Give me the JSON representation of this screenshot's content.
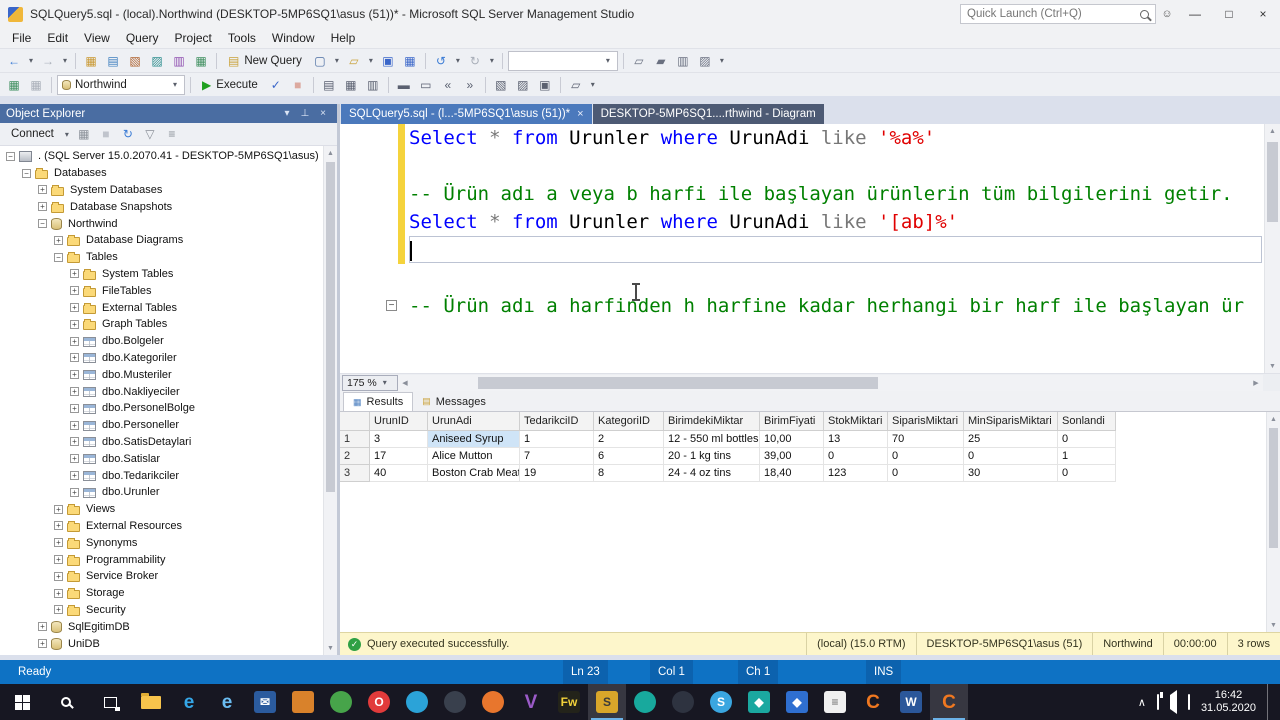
{
  "titlebar": {
    "title": "SQLQuery5.sql - (local).Northwind (DESKTOP-5MP6SQ1\\asus (51))* - Microsoft SQL Server Management Studio",
    "quick_launch_placeholder": "Quick Launch (Ctrl+Q)",
    "window_buttons": [
      {
        "n": "minimize-button",
        "g": "—"
      },
      {
        "n": "maximize-button",
        "g": "□"
      },
      {
        "n": "close-button",
        "g": "×"
      }
    ]
  },
  "menubar": {
    "items": [
      "File",
      "Edit",
      "View",
      "Query",
      "Project",
      "Tools",
      "Window",
      "Help"
    ]
  },
  "toolbar_standard": {
    "items": [
      {
        "t": "i",
        "n": "back-button",
        "g": "←",
        "c": "#3a7bd5"
      },
      {
        "t": "v",
        "n": "back-history-dropdown"
      },
      {
        "t": "i",
        "n": "forward-button",
        "g": "→",
        "c": "#a8aeb8"
      },
      {
        "t": "v",
        "n": "forward-history-dropdown"
      },
      {
        "t": "s"
      },
      {
        "t": "i",
        "n": "new-project-icon",
        "g": "▦",
        "c": "#c9972f"
      },
      {
        "t": "i",
        "n": "database-engine-query-icon",
        "g": "▤",
        "c": "#3f7fbf"
      },
      {
        "t": "i",
        "n": "analysis-services-query-icon",
        "g": "▧",
        "c": "#b0632f"
      },
      {
        "t": "i",
        "n": "mdx-query-icon",
        "g": "▨",
        "c": "#2f8f8f"
      },
      {
        "t": "i",
        "n": "dmx-query-icon",
        "g": "▥",
        "c": "#8f4fb0"
      },
      {
        "t": "i",
        "n": "xmla-query-icon",
        "g": "▦",
        "c": "#3f8f5f"
      },
      {
        "t": "s"
      },
      {
        "t": "b",
        "n": "new-query-button",
        "g": "▤",
        "c": "#caa23a",
        "label": "New Query"
      },
      {
        "t": "i",
        "n": "new-file-icon",
        "g": "▢",
        "c": "#4a6da2"
      },
      {
        "t": "v",
        "n": "new-file-dropdown"
      },
      {
        "t": "i",
        "n": "open-file-icon",
        "g": "▱",
        "c": "#caa23a"
      },
      {
        "t": "v",
        "n": "open-file-dropdown"
      },
      {
        "t": "i",
        "n": "save-icon",
        "g": "▣",
        "c": "#3a66c9"
      },
      {
        "t": "i",
        "n": "save-all-icon",
        "g": "▦",
        "c": "#3a66c9"
      },
      {
        "t": "s"
      },
      {
        "t": "i",
        "n": "undo-icon",
        "g": "↺",
        "c": "#3a7bd5"
      },
      {
        "t": "v",
        "n": "undo-dropdown"
      },
      {
        "t": "i",
        "n": "redo-icon",
        "g": "↻",
        "c": "#a8aeb8"
      },
      {
        "t": "v",
        "n": "redo-dropdown"
      },
      {
        "t": "s"
      },
      {
        "t": "c",
        "n": "deployment-target-combo",
        "v": "",
        "w": 110
      },
      {
        "t": "s"
      },
      {
        "t": "i",
        "n": "solution-explorer-icon",
        "g": "▱",
        "c": "#6a7080"
      },
      {
        "t": "i",
        "n": "properties-window-icon",
        "g": "▰",
        "c": "#6a7080"
      },
      {
        "t": "i",
        "n": "object-explorer-icon",
        "g": "▥",
        "c": "#6a7080"
      },
      {
        "t": "i",
        "n": "toolbox-icon",
        "g": "▨",
        "c": "#6a7080"
      },
      {
        "t": "v",
        "n": "toolbar-overflow-dropdown"
      }
    ]
  },
  "toolbar_sql": {
    "items": [
      {
        "t": "i",
        "n": "connect-icon",
        "g": "▦",
        "c": "#3f8f5f"
      },
      {
        "t": "i",
        "n": "change-connection-icon",
        "g": "▦",
        "c": "#a8aeb8"
      },
      {
        "t": "s"
      },
      {
        "t": "c",
        "n": "available-databases-combo",
        "v": "Northwind",
        "w": 128,
        "ic": "db"
      },
      {
        "t": "s"
      },
      {
        "t": "b",
        "n": "execute-button",
        "g": "▶",
        "c": "#1fa01f",
        "label": "Execute"
      },
      {
        "t": "i",
        "n": "parse-icon",
        "g": "✓",
        "c": "#3a66c9"
      },
      {
        "t": "i",
        "n": "cancel-query-icon",
        "g": "■",
        "c": "#c8553a",
        "dis": true
      },
      {
        "t": "s"
      },
      {
        "t": "i",
        "n": "results-to-text-icon",
        "g": "▤",
        "c": "#5a6070"
      },
      {
        "t": "i",
        "n": "results-to-grid-icon",
        "g": "▦",
        "c": "#5a6070"
      },
      {
        "t": "i",
        "n": "results-to-file-icon",
        "g": "▥",
        "c": "#5a6070"
      },
      {
        "t": "s"
      },
      {
        "t": "i",
        "n": "comment-selection-icon",
        "g": "▬",
        "c": "#5a6070"
      },
      {
        "t": "i",
        "n": "uncomment-selection-icon",
        "g": "▭",
        "c": "#5a6070"
      },
      {
        "t": "i",
        "n": "decrease-indent-icon",
        "g": "«",
        "c": "#5a6070"
      },
      {
        "t": "i",
        "n": "increase-indent-icon",
        "g": "»",
        "c": "#5a6070"
      },
      {
        "t": "s"
      },
      {
        "t": "i",
        "n": "include-actual-plan-icon",
        "g": "▧",
        "c": "#5a6070"
      },
      {
        "t": "i",
        "n": "include-client-statistics-icon",
        "g": "▨",
        "c": "#5a6070"
      },
      {
        "t": "i",
        "n": "query-options-icon",
        "g": "▣",
        "c": "#5a6070"
      },
      {
        "t": "s"
      },
      {
        "t": "i",
        "n": "sqlcmd-mode-icon",
        "g": "▱",
        "c": "#5a6070"
      },
      {
        "t": "v",
        "n": "toolbar-overflow-dropdown"
      }
    ]
  },
  "object_explorer": {
    "title": "Object Explorer",
    "header_icons": [
      {
        "n": "toolwindow-options-icon",
        "g": "▾"
      },
      {
        "n": "pin-icon",
        "g": "⊥"
      },
      {
        "n": "close-icon",
        "g": "×"
      }
    ],
    "toolbar_icons": [
      {
        "t": "b",
        "n": "connect-dropdown",
        "label": "Connect"
      },
      {
        "t": "v",
        "n": "connect-dropdown-caret"
      },
      {
        "t": "i",
        "n": "disconnect-icon",
        "g": "▦",
        "c": "#8a9098"
      },
      {
        "t": "i",
        "n": "stop-icon",
        "g": "■",
        "c": "#c0c4cc"
      },
      {
        "t": "i",
        "n": "refresh-icon",
        "g": "↻",
        "c": "#3a7bd5"
      },
      {
        "t": "i",
        "n": "filter-icon",
        "g": "▽",
        "c": "#8a9098"
      },
      {
        "t": "i",
        "n": "script-icon",
        "g": "≡",
        "c": "#8a9098"
      }
    ],
    "tree": [
      {
        "label": ". (SQL Server 15.0.2070.41 - DESKTOP-5MP6SQ1\\asus)",
        "lv": 0,
        "icon": "server",
        "exp": "minus"
      },
      {
        "label": "Databases",
        "lv": 1,
        "icon": "folder",
        "exp": "minus"
      },
      {
        "label": "System Databases",
        "lv": 2,
        "icon": "folder",
        "exp": "plus"
      },
      {
        "label": "Database Snapshots",
        "lv": 2,
        "icon": "folder",
        "exp": "plus"
      },
      {
        "label": "Northwind",
        "lv": 2,
        "icon": "database",
        "exp": "minus"
      },
      {
        "label": "Database Diagrams",
        "lv": 3,
        "icon": "folder",
        "exp": "plus"
      },
      {
        "label": "Tables",
        "lv": 3,
        "icon": "folder",
        "exp": "minus"
      },
      {
        "label": "System Tables",
        "lv": 4,
        "icon": "folder",
        "exp": "plus"
      },
      {
        "label": "FileTables",
        "lv": 4,
        "icon": "folder",
        "exp": "plus"
      },
      {
        "label": "External Tables",
        "lv": 4,
        "icon": "folder",
        "exp": "plus"
      },
      {
        "label": "Graph Tables",
        "lv": 4,
        "icon": "folder",
        "exp": "plus"
      },
      {
        "label": "dbo.Bolgeler",
        "lv": 4,
        "icon": "table",
        "exp": "plus"
      },
      {
        "label": "dbo.Kategoriler",
        "lv": 4,
        "icon": "table",
        "exp": "plus"
      },
      {
        "label": "dbo.Musteriler",
        "lv": 4,
        "icon": "table",
        "exp": "plus"
      },
      {
        "label": "dbo.Nakliyeciler",
        "lv": 4,
        "icon": "table",
        "exp": "plus"
      },
      {
        "label": "dbo.PersonelBolge",
        "lv": 4,
        "icon": "table",
        "exp": "plus"
      },
      {
        "label": "dbo.Personeller",
        "lv": 4,
        "icon": "table",
        "exp": "plus"
      },
      {
        "label": "dbo.SatisDetaylari",
        "lv": 4,
        "icon": "table",
        "exp": "plus"
      },
      {
        "label": "dbo.Satislar",
        "lv": 4,
        "icon": "table",
        "exp": "plus"
      },
      {
        "label": "dbo.Tedarikciler",
        "lv": 4,
        "icon": "table",
        "exp": "plus"
      },
      {
        "label": "dbo.Urunler",
        "lv": 4,
        "icon": "table",
        "exp": "plus"
      },
      {
        "label": "Views",
        "lv": 3,
        "icon": "folder",
        "exp": "plus"
      },
      {
        "label": "External Resources",
        "lv": 3,
        "icon": "folder",
        "exp": "plus"
      },
      {
        "label": "Synonyms",
        "lv": 3,
        "icon": "folder",
        "exp": "plus"
      },
      {
        "label": "Programmability",
        "lv": 3,
        "icon": "folder",
        "exp": "plus"
      },
      {
        "label": "Service Broker",
        "lv": 3,
        "icon": "folder",
        "exp": "plus"
      },
      {
        "label": "Storage",
        "lv": 3,
        "icon": "folder",
        "exp": "plus"
      },
      {
        "label": "Security",
        "lv": 3,
        "icon": "folder",
        "exp": "plus"
      },
      {
        "label": "SqlEgitimDB",
        "lv": 2,
        "icon": "database",
        "exp": "plus"
      },
      {
        "label": "UniDB",
        "lv": 2,
        "icon": "database",
        "exp": "plus"
      }
    ]
  },
  "tabs": [
    {
      "label": "SQLQuery5.sql - (l...-5MP6SQ1\\asus (51))*"
    },
    {
      "label": "DESKTOP-5MP6SQ1....rthwind - Diagram"
    }
  ],
  "editor": {
    "zoom": "175 %",
    "lines": [
      {
        "changed": true,
        "seg": [
          [
            "Select ",
            "kw"
          ],
          [
            "* ",
            "op"
          ],
          [
            "from ",
            "kw"
          ],
          [
            "Urunler ",
            "id"
          ],
          [
            "where ",
            "kw"
          ],
          [
            "UrunAdi ",
            "id"
          ],
          [
            "like ",
            "op"
          ],
          [
            "'%a%'",
            "str"
          ]
        ]
      },
      {
        "changed": true,
        "seg": []
      },
      {
        "changed": true,
        "seg": [
          [
            "-- Ürün adı a veya b harfi ile başlayan ürünlerin tüm bilgilerini getir.",
            "com"
          ]
        ]
      },
      {
        "changed": true,
        "seg": [
          [
            "Select ",
            "kw"
          ],
          [
            "* ",
            "op"
          ],
          [
            "from ",
            "kw"
          ],
          [
            "Urunler ",
            "id"
          ],
          [
            "where ",
            "kw"
          ],
          [
            "UrunAdi ",
            "id"
          ],
          [
            "like ",
            "op"
          ],
          [
            "'[ab]%'",
            "str"
          ]
        ]
      },
      {
        "changed": true,
        "cursor": true,
        "seg": []
      },
      {
        "seg": []
      },
      {
        "fold": "minus",
        "seg": [
          [
            "-- Ürün adı a harfinden h harfine kadar herhangi bir harf ile başlayan ür",
            "com"
          ]
        ]
      }
    ]
  },
  "results": {
    "tab_results": "Results",
    "tab_messages": "Messages",
    "columns": [
      "UrunID",
      "UrunAdi",
      "TedarikciID",
      "KategoriID",
      "BirimdekiMiktar",
      "BirimFiyati",
      "StokMiktari",
      "SiparisMiktari",
      "MinSiparisMiktari",
      "Sonlandi"
    ],
    "rows": [
      [
        "1",
        "3",
        "Aniseed Syrup",
        "1",
        "2",
        "12 - 550 ml bottles",
        "10,00",
        "13",
        "70",
        "25",
        "0"
      ],
      [
        "2",
        "17",
        "Alice Mutton",
        "7",
        "6",
        "20 - 1 kg tins",
        "39,00",
        "0",
        "0",
        "0",
        "1"
      ],
      [
        "3",
        "40",
        "Boston Crab Meat",
        "19",
        "8",
        "24 - 4 oz tins",
        "18,40",
        "123",
        "0",
        "30",
        "0"
      ]
    ]
  },
  "query_status": {
    "message": "Query executed successfully.",
    "server": "(local) (15.0 RTM)",
    "login": "DESKTOP-5MP6SQ1\\asus (51)",
    "database": "Northwind",
    "duration": "00:00:00",
    "rowcount": "3 rows"
  },
  "status_bar": {
    "mode": "Ready",
    "line": "Ln 23",
    "column": "Col 1",
    "char": "Ch 1",
    "insert_mode": "INS"
  },
  "taskbar": {
    "clock_time": "16:42",
    "clock_date": "31.05.2020",
    "icons": [
      {
        "n": "start-button",
        "k": "win"
      },
      {
        "n": "search-button",
        "k": "search"
      },
      {
        "n": "task-view-button",
        "k": "taskview"
      },
      {
        "n": "file-explorer-icon",
        "k": "folder"
      },
      {
        "n": "edge-browser-icon",
        "k": "g",
        "g": "e",
        "c": "#35a7e8"
      },
      {
        "n": "internet-explorer-icon",
        "k": "g",
        "g": "e",
        "c": "#6bbdf2"
      },
      {
        "n": "mail-app-icon",
        "k": "sq",
        "c": "#2b5b9e",
        "g": "✉"
      },
      {
        "n": "photos-app-icon",
        "k": "sq",
        "c": "#d9822b",
        "g": ""
      },
      {
        "n": "chrome-icon",
        "k": "ci",
        "c": "#47a44a",
        "g": ""
      },
      {
        "n": "opera-icon",
        "k": "ci",
        "c": "#e23b3b",
        "g": "O"
      },
      {
        "n": "telegram-icon",
        "k": "ci",
        "c": "#2ba3d8",
        "g": ""
      },
      {
        "n": "steam-icon",
        "k": "ci",
        "c": "#39404d",
        "g": ""
      },
      {
        "n": "firefox-icon",
        "k": "ci",
        "c": "#e8762d",
        "g": ""
      },
      {
        "n": "visual-studio-icon",
        "k": "g",
        "g": "V",
        "c": "#9b5bc8"
      },
      {
        "n": "fireworks-icon",
        "k": "sq",
        "c": "#23231a",
        "g": "Fw",
        "fg": "#f2d23a"
      },
      {
        "n": "ssms-icon",
        "k": "sq",
        "c": "#d9a62a",
        "g": "S",
        "fg": "#3a3a3a",
        "active": true
      },
      {
        "n": "camtasia-icon",
        "k": "ci",
        "c": "#18a99d",
        "g": ""
      },
      {
        "n": "obs-icon",
        "k": "ci",
        "c": "#2e3340",
        "g": ""
      },
      {
        "n": "skype-icon",
        "k": "ci",
        "c": "#3aa6e0",
        "g": "S"
      },
      {
        "n": "unity-hub-icon",
        "k": "sq",
        "c": "#1ba8a0",
        "g": "◆"
      },
      {
        "n": "blender-app-icon",
        "k": "sq",
        "c": "#2f6fd0",
        "g": "◆"
      },
      {
        "n": "notes-app-icon",
        "k": "sq",
        "c": "#f0f0f0",
        "g": "≡",
        "fg": "#666666"
      },
      {
        "n": "camtasia-recorder-icon",
        "k": "g",
        "g": "C",
        "c": "#f07820"
      },
      {
        "n": "word-icon",
        "k": "sq",
        "c": "#2b579a",
        "g": "W"
      },
      {
        "n": "camtasia-2020-icon",
        "k": "g",
        "g": "C",
        "c": "#f07820",
        "active": true
      }
    ],
    "tray_icons": [
      {
        "n": "tray-expand-icon",
        "k": "g",
        "g": "∧"
      },
      {
        "n": "network-icon",
        "k": "net"
      },
      {
        "n": "volume-icon",
        "k": "vol"
      },
      {
        "n": "action-center-icon",
        "k": "ac"
      }
    ]
  }
}
